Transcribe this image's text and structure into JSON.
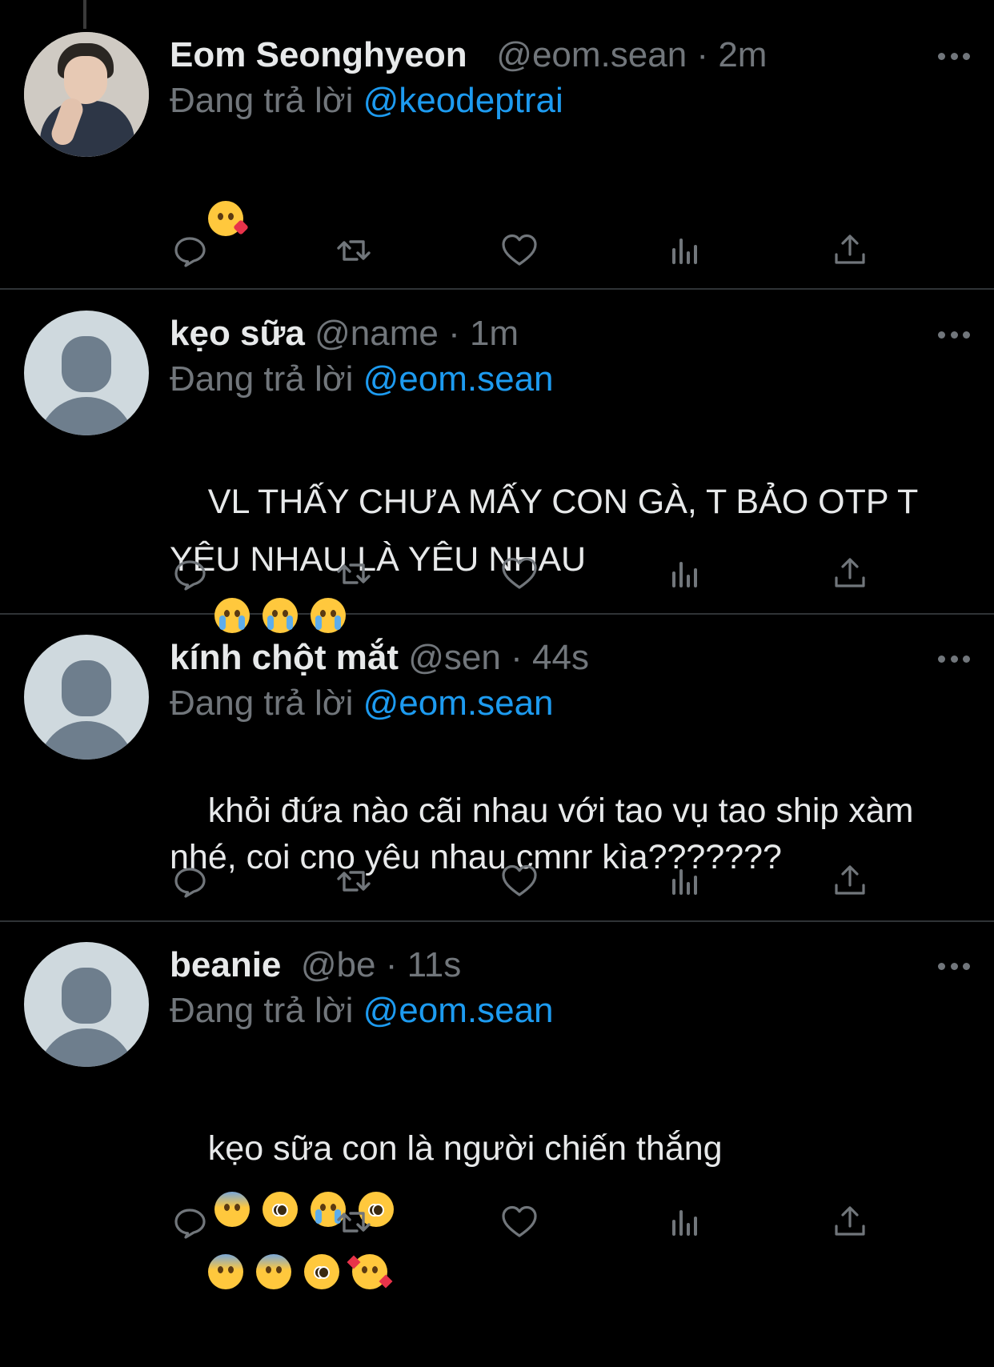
{
  "colors": {
    "background": "#000000",
    "text": "#E7E9EA",
    "muted": "#71767B",
    "link": "#1D9BF0",
    "divider": "#2F3336"
  },
  "reply_prefix": "Đang trả lời",
  "tweets": [
    {
      "avatar": "profile-photo",
      "name": "Eom Seonghyeon",
      "handle": "@eom.sean",
      "separator": "·",
      "time": "2m",
      "reply_to": "@keodeptrai",
      "text": "",
      "emojis": [
        "kissing-face-with-heart"
      ]
    },
    {
      "avatar": "default-avatar",
      "name": "kẹo sữa",
      "handle": "@name",
      "separator": "·",
      "time": "1m",
      "reply_to": "@eom.sean",
      "text": "VL THẤY CHƯA MẤY CON GÀ, T BẢO OTP T YÊU NHAU LÀ YÊU NHAU",
      "emojis": [
        "loudly-crying-face",
        "loudly-crying-face",
        "loudly-crying-face"
      ]
    },
    {
      "avatar": "default-avatar",
      "name": "kính chột mắt",
      "handle": "@sen",
      "separator": "·",
      "time": "44s",
      "reply_to": "@eom.sean",
      "text": "khỏi đứa nào cãi nhau với tao vụ tao ship xàm nhé, coi cno yêu nhau cmnr kìa???????",
      "emojis": []
    },
    {
      "avatar": "default-avatar",
      "name": "beanie",
      "handle": "@be",
      "separator": "·",
      "time": "11s",
      "reply_to": "@eom.sean",
      "text": "kẹo sữa con là người chiến thắng",
      "emojis": [
        "fearful-face",
        "pleading-face",
        "loudly-crying-face",
        "pleading-face",
        "fearful-face",
        "fearful-face",
        "pleading-face",
        "smiling-face-with-hearts"
      ]
    }
  ],
  "action_icons": [
    "reply-icon",
    "retweet-icon",
    "like-icon",
    "views-icon",
    "share-icon"
  ]
}
